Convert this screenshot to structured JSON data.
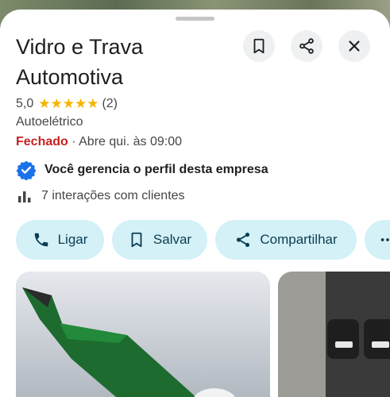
{
  "place": {
    "name": "Vidro e Trava Automotiva",
    "rating": "5,0",
    "stars": "★★★★★",
    "review_count": "(2)",
    "category": "Autoelétrico",
    "status": "Fechado",
    "hours_text": " · Abre qui. às 09:00",
    "verified_text": "Você gerencia o perfil desta empresa",
    "interactions_text": "7 interações com clientes"
  },
  "header_buttons": {
    "save_icon": "bookmark-icon",
    "share_icon": "share-icon",
    "close_icon": "close-icon"
  },
  "actions": [
    {
      "label": "Ligar",
      "icon": "phone-icon"
    },
    {
      "label": "Salvar",
      "icon": "bookmark-icon"
    },
    {
      "label": "Compartilhar",
      "icon": "share-icon"
    },
    {
      "label": "",
      "icon": "more-icon"
    }
  ],
  "colors": {
    "chip_bg": "#d3f1f7",
    "closed": "#c5221f",
    "star": "#f5b400",
    "verified_badge": "#1a73e8"
  }
}
